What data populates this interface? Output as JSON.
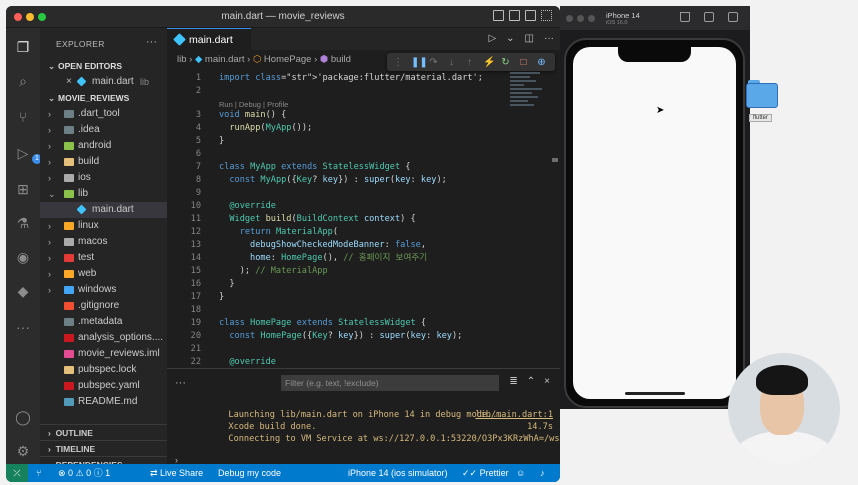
{
  "window": {
    "title": "main.dart — movie_reviews"
  },
  "sidebar": {
    "header": "EXPLORER",
    "open_editors": {
      "title": "OPEN EDITORS",
      "items": [
        {
          "label": "main.dart",
          "hint": "lib"
        }
      ]
    },
    "project": {
      "title": "MOVIE_REVIEWS",
      "tree": [
        {
          "label": ".dart_tool",
          "kind": "folder"
        },
        {
          "label": ".idea",
          "kind": "folder"
        },
        {
          "label": "android",
          "kind": "folder"
        },
        {
          "label": "build",
          "kind": "folder"
        },
        {
          "label": "ios",
          "kind": "folder"
        },
        {
          "label": "lib",
          "kind": "folder-open"
        },
        {
          "label": "main.dart",
          "kind": "dart"
        },
        {
          "label": "linux",
          "kind": "folder"
        },
        {
          "label": "macos",
          "kind": "folder"
        },
        {
          "label": "test",
          "kind": "folder"
        },
        {
          "label": "web",
          "kind": "folder"
        },
        {
          "label": "windows",
          "kind": "folder"
        },
        {
          "label": ".gitignore",
          "kind": "git"
        },
        {
          "label": ".metadata",
          "kind": "meta"
        },
        {
          "label": "analysis_options....",
          "kind": "yaml"
        },
        {
          "label": "movie_reviews.iml",
          "kind": "iml"
        },
        {
          "label": "pubspec.lock",
          "kind": "lock"
        },
        {
          "label": "pubspec.yaml",
          "kind": "yaml"
        },
        {
          "label": "README.md",
          "kind": "md"
        }
      ]
    },
    "bottom": {
      "outline": "OUTLINE",
      "timeline": "TIMELINE",
      "dependencies": "DEPENDENCIES"
    }
  },
  "editor": {
    "tab": "main.dart",
    "breadcrumb": {
      "folder": "lib",
      "file": "main.dart",
      "class": "HomePage",
      "method": "build"
    },
    "codelens": "Run | Debug | Profile",
    "lines": [
      {
        "n": "1",
        "text": "import 'package:flutter/material.dart';"
      },
      {
        "n": "2",
        "text": ""
      },
      {
        "n": "3",
        "text": "void main() {"
      },
      {
        "n": "4",
        "text": "  runApp(MyApp());"
      },
      {
        "n": "5",
        "text": "}"
      },
      {
        "n": "6",
        "text": ""
      },
      {
        "n": "7",
        "text": "class MyApp extends StatelessWidget {"
      },
      {
        "n": "8",
        "text": "  const MyApp({Key? key}) : super(key: key);"
      },
      {
        "n": "9",
        "text": ""
      },
      {
        "n": "10",
        "text": "  @override"
      },
      {
        "n": "11",
        "text": "  Widget build(BuildContext context) {"
      },
      {
        "n": "12",
        "text": "    return MaterialApp("
      },
      {
        "n": "13",
        "text": "      debugShowCheckedModeBanner: false,"
      },
      {
        "n": "14",
        "text": "      home: HomePage(), // 홈페이지 보여주기"
      },
      {
        "n": "15",
        "text": "    ); // MaterialApp"
      },
      {
        "n": "16",
        "text": "  }"
      },
      {
        "n": "17",
        "text": "}"
      },
      {
        "n": "18",
        "text": ""
      },
      {
        "n": "19",
        "text": "class HomePage extends StatelessWidget {"
      },
      {
        "n": "20",
        "text": "  const HomePage({Key? key}) : super(key: key);"
      },
      {
        "n": "21",
        "text": ""
      },
      {
        "n": "22",
        "text": "  @override"
      }
    ]
  },
  "panel": {
    "filter_placeholder": "Filter (e.g. text, !exclude)",
    "output": [
      {
        "text": "Launching lib/main.dart on iPhone 14 in debug mode...",
        "right": "lib/main.dart:1"
      },
      {
        "text": "Xcode build done.",
        "right": "14.7s"
      },
      {
        "text": "Connecting to VM Service at ws://127.0.0.1:53220/O3Px3KRzWhA=/ws",
        "right": ""
      }
    ]
  },
  "statusbar": {
    "problems": "0",
    "warnings": "0",
    "info": "1",
    "live_share": "Live Share",
    "debug_mode": "Debug my code",
    "device": "iPhone 14 (ios simulator)",
    "prettier": "Prettier"
  },
  "simulator": {
    "device": "iPhone 14",
    "os": "iOS 16.0"
  },
  "desktop": {
    "folder_label": "flutter"
  },
  "colors": {
    "accent": "#007acc",
    "remote": "#16825d",
    "tab_border": "#3b8eea"
  }
}
